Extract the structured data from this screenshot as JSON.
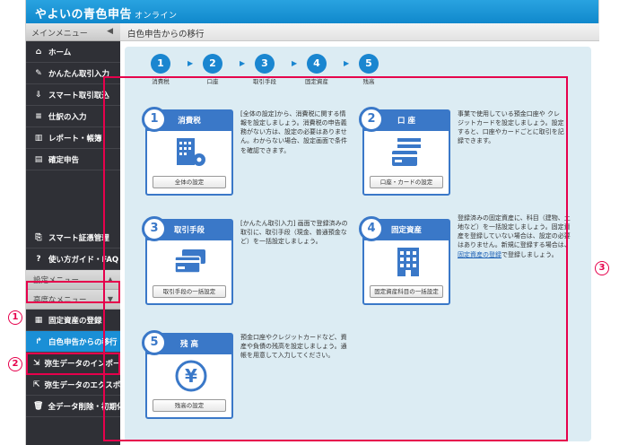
{
  "header": {
    "brand": "やよいの青色申告",
    "brand_sub": "オンライン"
  },
  "sidebar": {
    "main_menu_label": "メインメニュー",
    "items": [
      {
        "label": "ホーム",
        "icon": "home-icon"
      },
      {
        "label": "かんたん取引入力",
        "icon": "pencil-icon"
      },
      {
        "label": "スマート取引取込",
        "icon": "import-icon"
      },
      {
        "label": "仕訳の入力",
        "icon": "journal-icon"
      },
      {
        "label": "レポート・帳簿",
        "icon": "report-icon"
      },
      {
        "label": "確定申告",
        "icon": "tax-return-icon"
      }
    ],
    "bottom_items": [
      {
        "label": "スマート証憑管理",
        "icon": "voucher-icon"
      },
      {
        "label": "使い方ガイド・FAQ",
        "icon": "help-icon"
      }
    ],
    "settings_menu_label": "設定メニュー",
    "advanced_menu_label": "高度なメニュー",
    "advanced_items": [
      {
        "label": "固定資産の登録",
        "icon": "fixed-asset-icon"
      },
      {
        "label": "白色申告からの移行",
        "icon": "migrate-icon"
      },
      {
        "label": "弥生データのインポート",
        "icon": "import-data-icon"
      },
      {
        "label": "弥生データのエクスポート",
        "icon": "export-data-icon"
      },
      {
        "label": "全データ削除・初期化",
        "icon": "trash-icon"
      }
    ]
  },
  "main": {
    "title": "白色申告からの移行",
    "steps": [
      {
        "num": "1",
        "label": "消費税"
      },
      {
        "num": "2",
        "label": "口座"
      },
      {
        "num": "3",
        "label": "取引手段"
      },
      {
        "num": "4",
        "label": "固定資産"
      },
      {
        "num": "5",
        "label": "残高"
      }
    ],
    "cards": [
      {
        "num": "1",
        "title": "消費税",
        "button": "全体の設定",
        "desc": "[全体の設定]から、消費税に関する情報を設定しましょう。消費税の申告義務がない方は、設定の必要はありません。わからない場合、設定画面で条件を確認できます。"
      },
      {
        "num": "2",
        "title": "口 座",
        "button": "口座・カードの設定",
        "desc": "事業で使用している預金口座や クレジットカードを設定しましょう。設定すると、口座やカードごとに取引を記録できます。"
      },
      {
        "num": "3",
        "title": "取引手段",
        "button": "取引手段の一括設定",
        "desc": "[かんたん取引入力] 画面で登録済みの取引に、取引手段（現金、普通預金など）を一括設定しましょう。"
      },
      {
        "num": "4",
        "title": "固定資産",
        "button": "固定資産科目の一括設定",
        "desc": "登録済みの固定資産に、科目（建物、土地など）を一括設定しましょう。固定資産を登録していない場合は、設定の必要はありません。新規に登録する場合は、",
        "link": "固定資産の登録",
        "desc_tail": "で登録しましょう。"
      },
      {
        "num": "5",
        "title": "残 高",
        "button": "残高の設定",
        "desc": "預金口座やクレジットカードなど、資産や負債の残高を設定しましょう。通帳を用意して入力してください。"
      }
    ]
  },
  "markers": {
    "m1": "1",
    "m2": "2",
    "m3": "3"
  },
  "colors": {
    "accent": "#1a86d0",
    "card": "#3a78c8",
    "highlight": "#e6004c",
    "panel": "#dcecf3"
  }
}
